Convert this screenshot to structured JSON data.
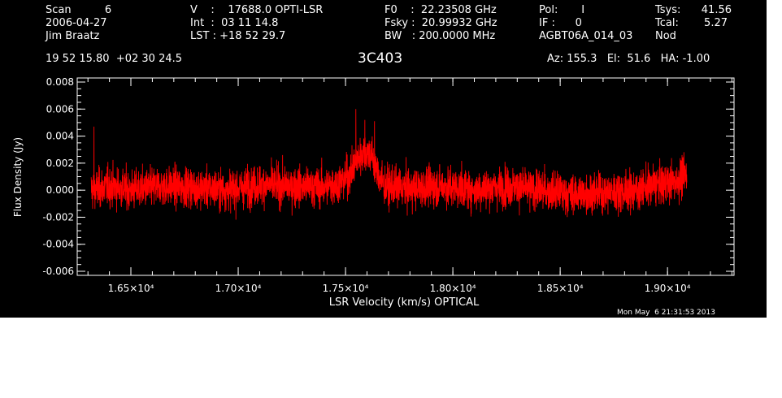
{
  "header": {
    "col1": [
      "Scan          6",
      "2006-04-27",
      "Jim Braatz"
    ],
    "col2": [
      "V    :    17688.0 OPTI-LSR",
      "Int  :  03 11 14.8",
      "LST : +18 52 29.7"
    ],
    "col3": [
      "F0    :  22.23508 GHz",
      "Fsky :  20.99932 GHz",
      "BW   : 200.0000 MHz"
    ],
    "col4": [
      "Pol:       I",
      "IF :      0",
      "AGBT06A_014_03"
    ],
    "col5": [
      "Tsys:",
      "Tcal:",
      "Nod"
    ],
    "col5_values": [
      "41.56",
      "5.27",
      ""
    ],
    "coords": "19 52 15.80  +02 30 24.5",
    "source": "3C403",
    "pointing": "Az: 155.3   El:  51.6   HA: -1.00",
    "timestamp": "Mon May  6 21:31:53 2013"
  },
  "chart_data": {
    "type": "line",
    "title": "3C403",
    "xlabel": "LSR Velocity (km/s) OPTICAL",
    "ylabel": "Flux Density (Jy)",
    "xlim": [
      16250,
      19310
    ],
    "ylim": [
      -0.0063,
      0.0083
    ],
    "x_ticks": [
      16500,
      17000,
      17500,
      18000,
      18500,
      19000
    ],
    "x_tick_labels": [
      "1.65×10⁴",
      "1.70×10⁴",
      "1.75×10⁴",
      "1.80×10⁴",
      "1.85×10⁴",
      "1.90×10⁴"
    ],
    "y_ticks": [
      -0.006,
      -0.004,
      -0.002,
      0.0,
      0.002,
      0.004,
      0.006,
      0.008
    ],
    "y_tick_labels": [
      "-0.006",
      "-0.004",
      "-0.002",
      "0.000",
      "0.002",
      "0.004",
      "0.006",
      "0.008"
    ],
    "series": [
      {
        "color": "#ff0000",
        "x_start": 16315,
        "x_end": 19090,
        "baseline": [
          [
            16315,
            0.0
          ],
          [
            16400,
            0.0003
          ],
          [
            16500,
            0.0
          ],
          [
            16650,
            0.0003
          ],
          [
            16800,
            0.0002
          ],
          [
            16950,
            0.0
          ],
          [
            17100,
            0.0004
          ],
          [
            17250,
            0.0003
          ],
          [
            17400,
            0.0002
          ],
          [
            17480,
            0.0006
          ],
          [
            17530,
            0.0014
          ],
          [
            17560,
            0.0024
          ],
          [
            17590,
            0.0029
          ],
          [
            17620,
            0.0026
          ],
          [
            17650,
            0.0012
          ],
          [
            17680,
            0.0003
          ],
          [
            17800,
            0.0001
          ],
          [
            17950,
            0.0003
          ],
          [
            18100,
            0.0
          ],
          [
            18250,
            0.0003
          ],
          [
            18400,
            0.0
          ],
          [
            18550,
            -0.0003
          ],
          [
            18700,
            -0.0002
          ],
          [
            18850,
            0.0
          ],
          [
            18950,
            0.0004
          ],
          [
            19030,
            0.0006
          ],
          [
            19090,
            0.0012
          ]
        ],
        "noise_sigma": 0.0012,
        "peak_values": [
          [
            17548,
            0.006
          ],
          [
            17590,
            0.0052
          ],
          [
            17635,
            0.0051
          ],
          [
            16328,
            0.0047
          ]
        ]
      }
    ],
    "grid": false
  }
}
